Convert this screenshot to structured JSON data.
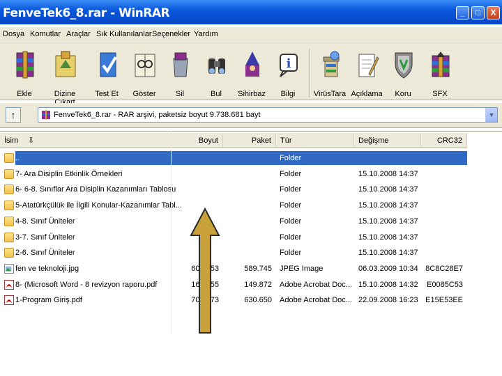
{
  "window": {
    "title": "FenveTek6_8.rar - WinRAR",
    "minimize": "_",
    "maximize": "□",
    "close": "X"
  },
  "menu": [
    "Dosya",
    "Komutlar",
    "Araçlar",
    "Sık Kullanılanlar",
    "Seçenekler",
    "Yardım"
  ],
  "toolbar": [
    {
      "label": "Ekle",
      "icon": "add-archive-icon"
    },
    {
      "label": "Dizine Çıkart",
      "icon": "extract-to-icon"
    },
    {
      "label": "Test Et",
      "icon": "test-icon"
    },
    {
      "label": "Göster",
      "icon": "view-icon"
    },
    {
      "label": "Sil",
      "icon": "delete-icon"
    },
    {
      "label": "Bul",
      "icon": "find-icon"
    },
    {
      "label": "Sihirbaz",
      "icon": "wizard-icon"
    },
    {
      "label": "Bilgi",
      "icon": "info-icon"
    },
    {
      "label": "VirüsTara",
      "icon": "virus-scan-icon"
    },
    {
      "label": "Açıklama",
      "icon": "comment-icon"
    },
    {
      "label": "Koru",
      "icon": "protect-icon"
    },
    {
      "label": "SFX",
      "icon": "sfx-icon"
    }
  ],
  "address": {
    "up_label": "↑",
    "path": "FenveTek6_8.rar - RAR arşivi, paketsiz boyut 9.738.681 bayt"
  },
  "columns": {
    "name": "İsim",
    "size": "Boyut",
    "packed": "Paket",
    "type": "Tür",
    "modified": "Değişme",
    "crc": "CRC32"
  },
  "files": [
    {
      "name": "..",
      "size": "",
      "packed": "",
      "type": "Folder",
      "modified": "",
      "crc": "",
      "kind": "folder",
      "selected": true
    },
    {
      "name": "7- Ara Disiplin Etkinlik Örnekleri",
      "size": "",
      "packed": "",
      "type": "Folder",
      "modified": "15.10.2008 14:37",
      "crc": "",
      "kind": "folder"
    },
    {
      "name": "6- 6-8. Sınıflar Ara Disiplin Kazanımları Tablosu",
      "size": "",
      "packed": "",
      "type": "Folder",
      "modified": "15.10.2008 14:37",
      "crc": "",
      "kind": "folder"
    },
    {
      "name": "5-Atatürkçülük ile İlgili Konular-Kazanımlar Tabl...",
      "size": "",
      "packed": "",
      "type": "Folder",
      "modified": "15.10.2008 14:37",
      "crc": "",
      "kind": "folder"
    },
    {
      "name": "4-8. Sınıf Üniteler",
      "size": "",
      "packed": "",
      "type": "Folder",
      "modified": "15.10.2008 14:37",
      "crc": "",
      "kind": "folder"
    },
    {
      "name": "3-7. Sınıf Üniteler",
      "size": "",
      "packed": "",
      "type": "Folder",
      "modified": "15.10.2008 14:37",
      "crc": "",
      "kind": "folder"
    },
    {
      "name": "2-6. Sınıf Üniteler",
      "size": "",
      "packed": "",
      "type": "Folder",
      "modified": "15.10.2008 14:37",
      "crc": "",
      "kind": "folder"
    },
    {
      "name": "fen ve teknoloji.jpg",
      "size": "600.053",
      "packed": "589.745",
      "type": "JPEG Image",
      "modified": "06.03.2009 10:34",
      "crc": "8C8C28E7",
      "kind": "jpg"
    },
    {
      "name": "8- (Microsoft Word - 8 revizyon raporu.pdf",
      "size": "162.355",
      "packed": "149.872",
      "type": "Adobe Acrobat Doc...",
      "modified": "15.10.2008 14:32",
      "crc": "E0085C53",
      "kind": "pdf"
    },
    {
      "name": "1-Program Giriş.pdf",
      "size": "709.773",
      "packed": "630.650",
      "type": "Adobe Acrobat Doc...",
      "modified": "22.09.2008 16:23",
      "crc": "E15E53EE",
      "kind": "pdf"
    }
  ],
  "colors": {
    "titlebar": "#0a58dc",
    "selection": "#316ac5",
    "arrow": "#c9a13a"
  }
}
